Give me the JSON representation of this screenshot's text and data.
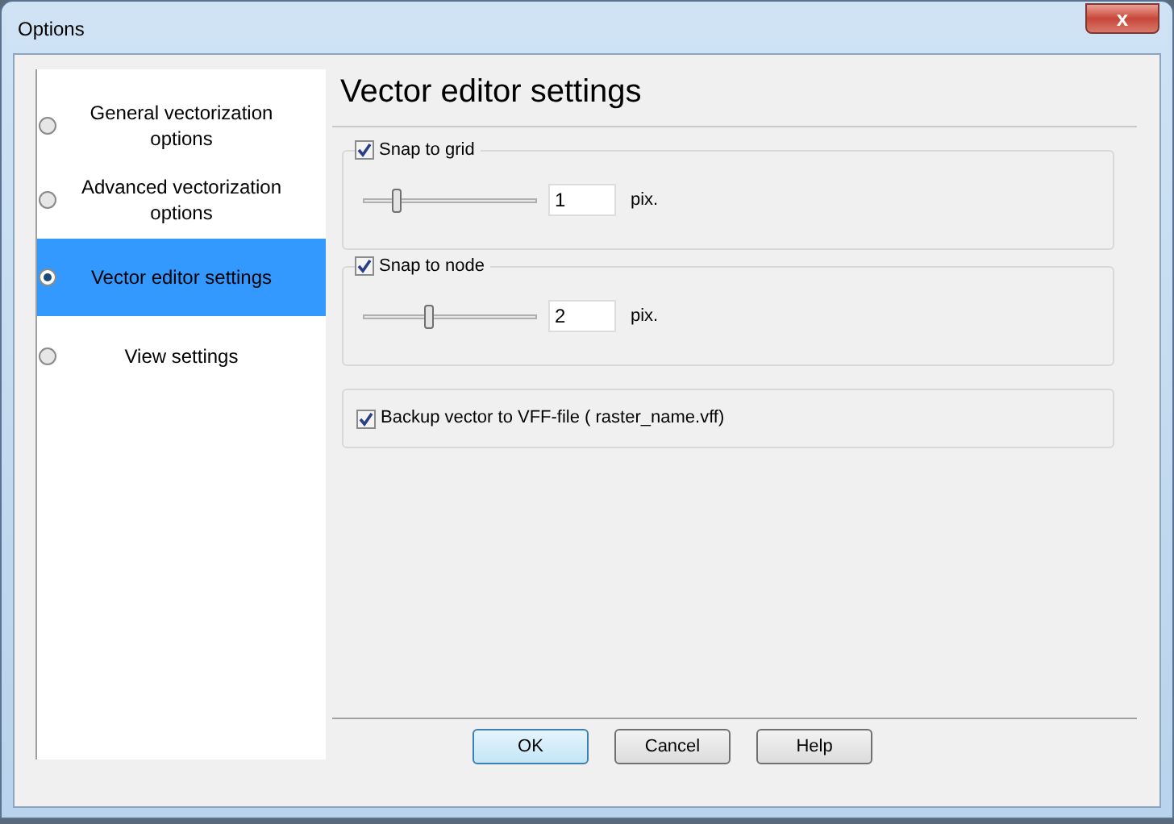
{
  "window": {
    "title": "Options",
    "close": "x"
  },
  "sidebar": {
    "items": [
      {
        "label": "General vectorization options",
        "selected": false
      },
      {
        "label": "Advanced vectorization options",
        "selected": false
      },
      {
        "label": "Vector editor settings",
        "selected": true
      },
      {
        "label": "View settings",
        "selected": false
      }
    ]
  },
  "panel": {
    "heading": "Vector editor settings",
    "groups": [
      {
        "kind": "slider",
        "label": "Snap to grid",
        "checked": true,
        "level": 0.2,
        "value": "1",
        "unit": "pix."
      },
      {
        "kind": "slider",
        "label": "Snap to node",
        "checked": true,
        "level": 0.4,
        "value": "2",
        "unit": "pix."
      },
      {
        "kind": "check",
        "label": "Backup vector to VFF-file ( raster_name.vff)",
        "checked": true
      }
    ]
  },
  "buttons": [
    {
      "label": "OK",
      "default": true
    },
    {
      "label": "Cancel",
      "default": false
    },
    {
      "label": "Help",
      "default": false
    }
  ]
}
